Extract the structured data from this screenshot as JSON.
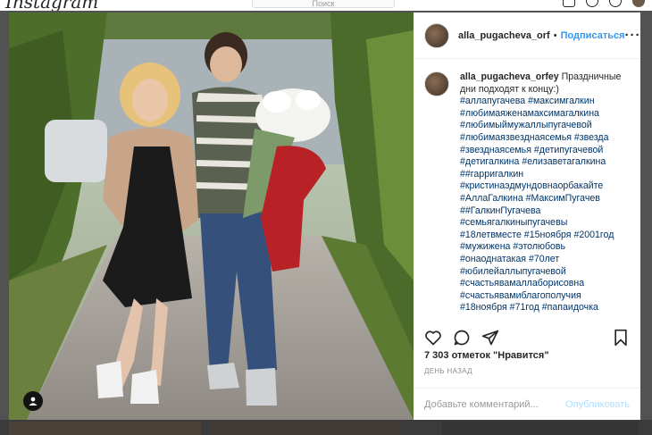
{
  "topbar": {
    "logo": "Instagram",
    "search_placeholder": "Поиск"
  },
  "post": {
    "header": {
      "username": "alla_pugacheva_orf",
      "separator": "•",
      "follow_label": "Подписаться",
      "more_label": "···"
    },
    "caption": {
      "username": "alla_pugacheva_orfey",
      "text": "Праздничные дни подходят к концу:)",
      "hashtags": [
        "#аллапугачева #максимгалкин",
        "#любимаяженамаксимагалкина",
        "#любимыймужаллыпугачевой",
        "#любимаязвезднаясемья #звезда",
        "#звезднаясемья #детипугачевой",
        "#детигалкина #елизаветагалкина",
        "##гарригалкин",
        "#кристинаэдмундовнаорбакайте",
        "#АллаГалкина #МаксимПугачев",
        "##ГалкинПугачева",
        "#семьягалкиныпугачевы",
        "#18летвместе #15ноября #2001год",
        "#мужижена #этолюбовь",
        "#онаоднатакая #70лет",
        "#юбилейаллыпугачевой",
        "#счастьявамаллаборисовна",
        "#счастьявамиблагополучия",
        "#18ноября #71год #папаидочка"
      ]
    },
    "actions": {
      "like_icon": "heart-icon",
      "comment_icon": "comment-icon",
      "share_icon": "share-icon",
      "save_icon": "bookmark-icon"
    },
    "likes_text": "7 303 отметок \"Нравится\"",
    "time_text": "ДЕНЬ НАЗАД",
    "comment_placeholder": "Добавьте комментарий...",
    "publish_label": "Опубликовать"
  },
  "colors": {
    "accent": "#3897f0",
    "hashtag": "#003569",
    "publish_disabled": "#b2dffc",
    "muted": "#8e8e8e"
  }
}
